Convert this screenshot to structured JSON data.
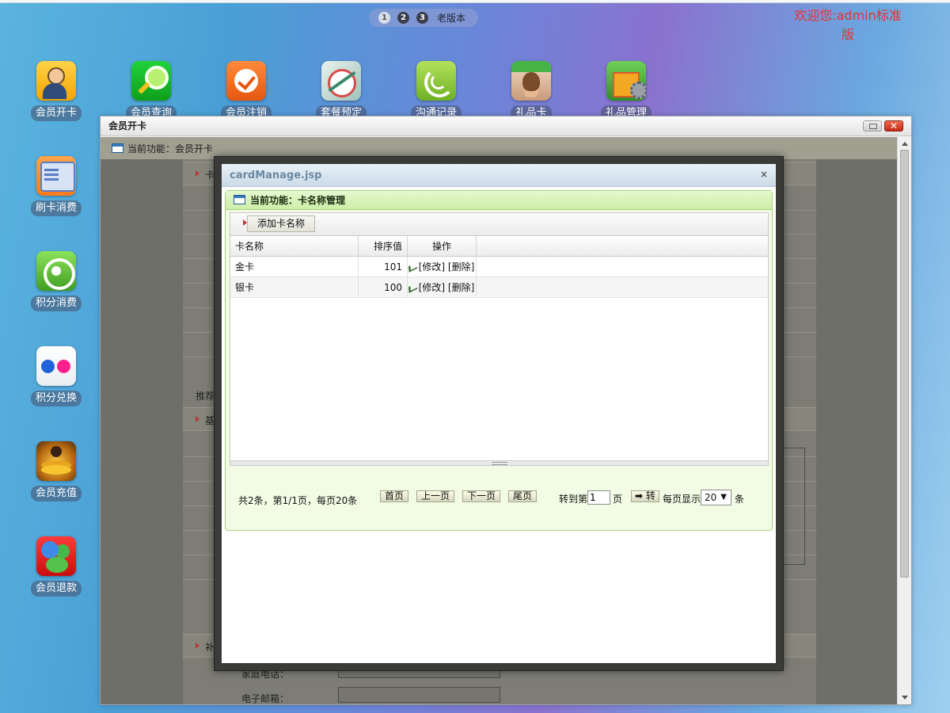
{
  "desktop": {
    "pager": {
      "pages": [
        "1",
        "2",
        "3"
      ],
      "old_version": "老版本"
    },
    "welcome": "欢迎您:admin标准版",
    "icons": [
      {
        "label": "会员开卡",
        "icon": "member-user-icon"
      },
      {
        "label": "会员查询",
        "icon": "magnifier-icon"
      },
      {
        "label": "会员注销",
        "icon": "checkmark-icon"
      },
      {
        "label": "套餐预定",
        "icon": "target-icon"
      },
      {
        "label": "沟通记录",
        "icon": "swirl-icon"
      },
      {
        "label": "礼品卡",
        "icon": "photo-card-icon"
      },
      {
        "label": "礼品管理",
        "icon": "gift-box-icon"
      },
      {
        "label": "刷卡消费",
        "icon": "card-swipe-icon"
      },
      {
        "label": "积分消费",
        "icon": "points-ring-icon"
      },
      {
        "label": "积分兑换",
        "icon": "flickr-dots-icon"
      },
      {
        "label": "会员充值",
        "icon": "coins-icon"
      },
      {
        "label": "会员退款",
        "icon": "refund-people-icon"
      }
    ]
  },
  "window": {
    "title": "会员开卡",
    "background": {
      "current_function": "当前功能：会员开卡",
      "section_card": "卡",
      "recommender": "推荐人",
      "section_basic": "基",
      "section_extra": "补",
      "home_phone": "家庭电话：",
      "email": "电子邮箱："
    }
  },
  "dialog": {
    "title": "cardManage.jsp",
    "close": "×",
    "current_function": "当前功能：卡名称管理",
    "add_button": "添加卡名称",
    "columns": [
      "卡名称",
      "排序值",
      "操作"
    ],
    "rows": [
      {
        "name": "金卡",
        "sort": "101",
        "edit": "[修改]",
        "del": "[删除]"
      },
      {
        "name": "银卡",
        "sort": "100",
        "edit": "[修改]",
        "del": "[删除]"
      }
    ],
    "pager": {
      "summary": "共2条，第1/1页，每页20条",
      "first": "首页",
      "prev": "上一页",
      "next": "下一页",
      "last": "尾页",
      "goto_label": "转到第",
      "goto_value": "1",
      "page_unit": "页",
      "go": "转",
      "per_page_label": "每页显示",
      "per_page_value": "20",
      "per_page_unit": "条"
    }
  },
  "colors": {
    "welcome_text": "#e8322f",
    "panel_border": "#a9cf83",
    "panel_header": "#cdeea8",
    "dialog_title_text": "#6c8aa2"
  }
}
